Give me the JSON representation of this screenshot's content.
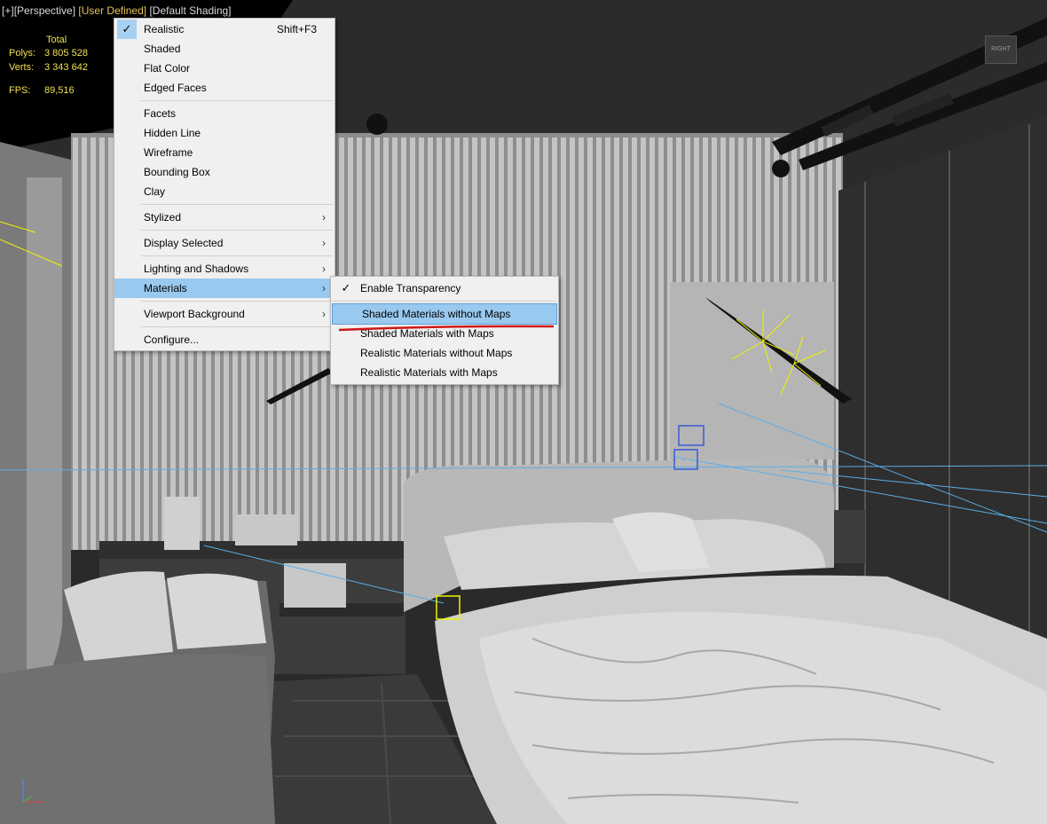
{
  "viewport": {
    "label_plus": "[+]",
    "label_view": "[Perspective]",
    "label_mode": "[User Defined]",
    "label_shading": "[Default Shading]",
    "stats": {
      "header": "Total",
      "polys_label": "Polys:",
      "polys_value": "3 805 528",
      "verts_label": "Verts:",
      "verts_value": "3 343 642",
      "fps_label": "FPS:",
      "fps_value": "89,516"
    },
    "viewcube_label": "RIGHT",
    "colors": {
      "highlight_text": "#e8c35a",
      "stats_text": "#f0e050",
      "selection": "#99c9ef",
      "annotation_line": "#d01818"
    }
  },
  "menu": {
    "items": [
      {
        "label": "Realistic",
        "shortcut": "Shift+F3",
        "checked": true
      },
      {
        "label": "Shaded"
      },
      {
        "label": "Flat Color"
      },
      {
        "label": "Edged Faces"
      },
      {
        "label": "Facets"
      },
      {
        "label": "Hidden Line"
      },
      {
        "label": "Wireframe"
      },
      {
        "label": "Bounding Box"
      },
      {
        "label": "Clay"
      },
      {
        "label": "Stylized",
        "submenu": true
      },
      {
        "label": "Display Selected",
        "submenu": true
      },
      {
        "label": "Lighting and Shadows",
        "submenu": true
      },
      {
        "label": "Materials",
        "submenu": true,
        "selected": true
      },
      {
        "label": "Viewport Background",
        "submenu": true
      },
      {
        "label": "Configure..."
      }
    ],
    "arrow_glyph": "›",
    "check_glyph": "✓"
  },
  "submenu": {
    "items": [
      {
        "label": "Enable Transparency",
        "checked": true
      },
      {
        "label": "Shaded Materials without Maps",
        "highlighted": true
      },
      {
        "label": "Shaded Materials with Maps"
      },
      {
        "label": "Realistic Materials without Maps"
      },
      {
        "label": "Realistic Materials with Maps"
      }
    ]
  }
}
